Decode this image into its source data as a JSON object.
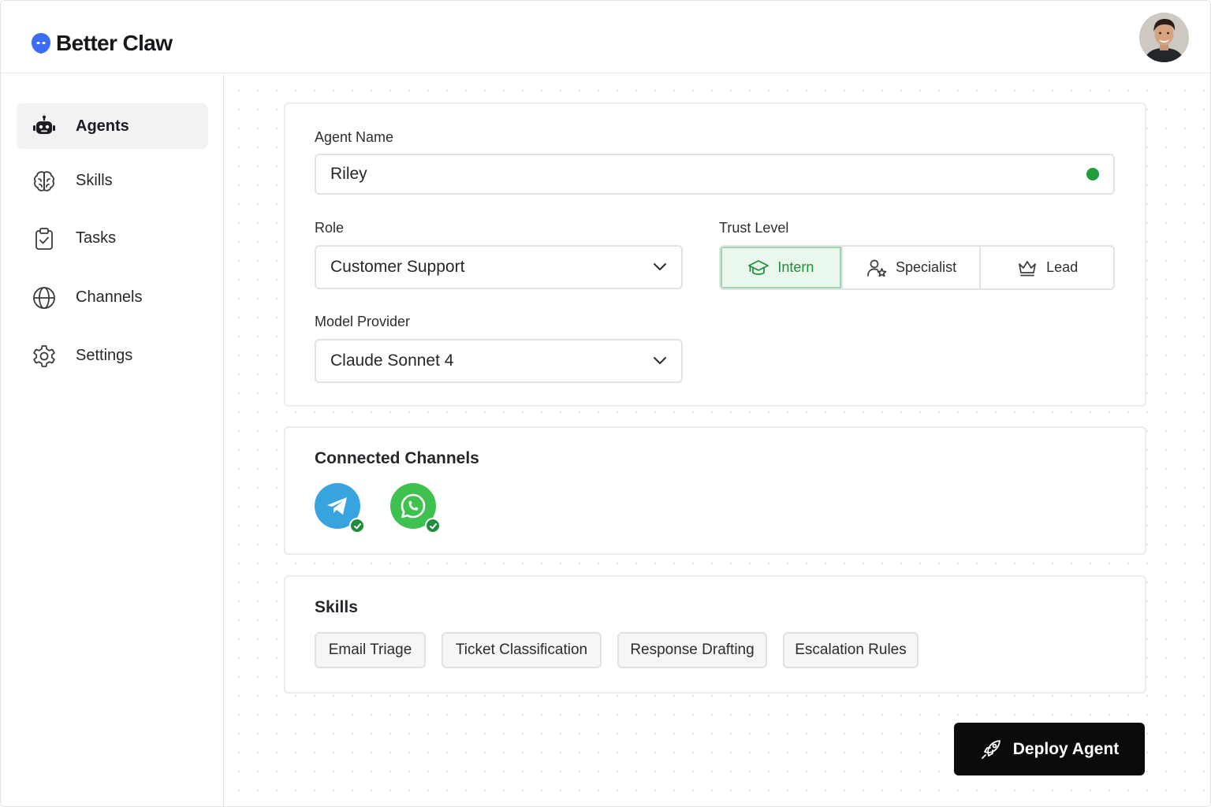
{
  "app": {
    "name": "Better Claw",
    "brand_color": "#3b6cf5"
  },
  "header": {
    "avatar_icon": "user-avatar"
  },
  "sidebar": {
    "items": [
      {
        "label": "Agents",
        "icon": "robot-icon",
        "active": true
      },
      {
        "label": "Skills",
        "icon": "brain-icon",
        "active": false
      },
      {
        "label": "Tasks",
        "icon": "clipboard-check-icon",
        "active": false
      },
      {
        "label": "Channels",
        "icon": "globe-icon",
        "active": false
      },
      {
        "label": "Settings",
        "icon": "gear-icon",
        "active": false
      }
    ]
  },
  "form": {
    "agent_name_label": "Agent Name",
    "agent_name_value": "Riley",
    "agent_status_color": "#1f9d3a",
    "role_label": "Role",
    "role_value": "Customer Support",
    "trust_label": "Trust Level",
    "trust_options": [
      {
        "label": "Intern",
        "icon": "graduation-cap-icon",
        "selected": true
      },
      {
        "label": "Specialist",
        "icon": "user-star-icon",
        "selected": false
      },
      {
        "label": "Lead",
        "icon": "crown-icon",
        "selected": false
      }
    ],
    "model_label": "Model Provider",
    "model_value": "Claude Sonnet 4"
  },
  "channels": {
    "title": "Connected Channels",
    "items": [
      {
        "icon": "telegram-icon",
        "color": "#37a4e0",
        "connected": true
      },
      {
        "icon": "whatsapp-icon",
        "color": "#3fc150",
        "connected": true
      }
    ]
  },
  "skills": {
    "title": "Skills",
    "items": [
      "Email Triage",
      "Ticket Classification",
      "Response Drafting",
      "Escalation Rules"
    ]
  },
  "actions": {
    "deploy_label": "Deploy Agent",
    "deploy_icon": "rocket-icon"
  }
}
